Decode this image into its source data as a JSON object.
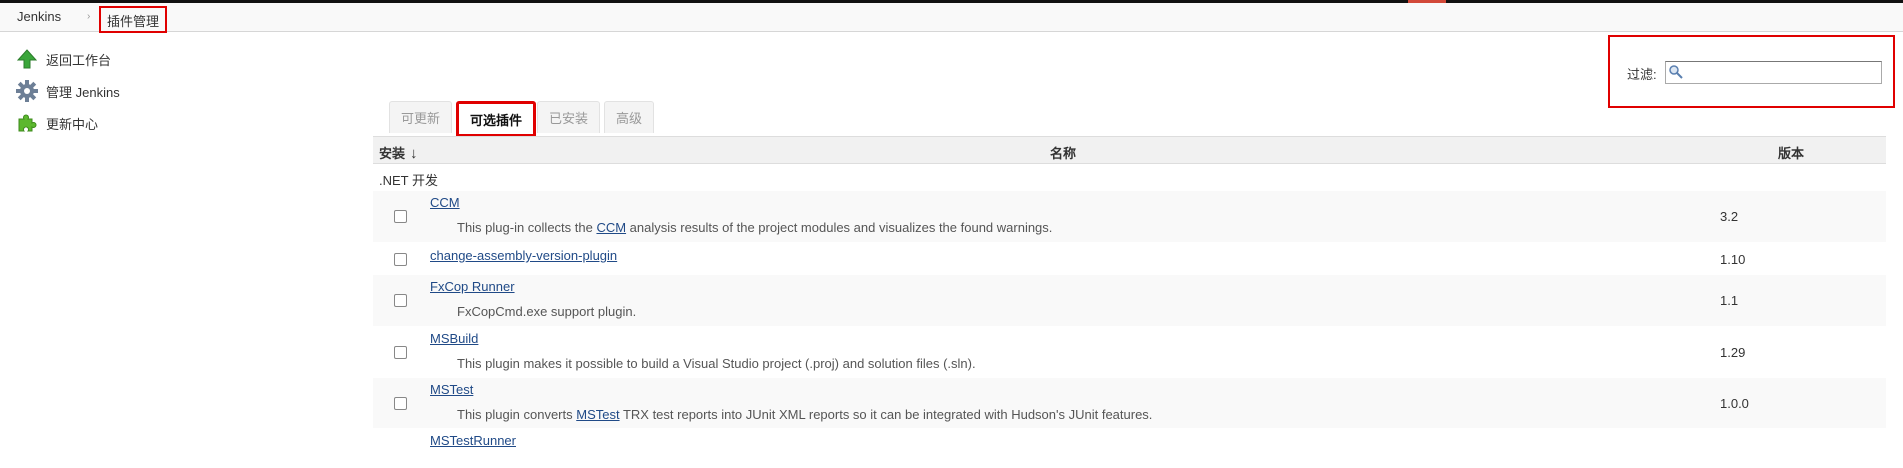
{
  "breadcrumb": {
    "home": "Jenkins",
    "current": "插件管理"
  },
  "sidebar": {
    "items": [
      {
        "label": "返回工作台",
        "icon": "up-arrow-icon"
      },
      {
        "label": "管理 Jenkins",
        "icon": "gear-icon"
      },
      {
        "label": "更新中心",
        "icon": "puzzle-icon"
      }
    ]
  },
  "filter": {
    "label": "过滤:",
    "value": "",
    "placeholder": ""
  },
  "tabs": [
    {
      "label": "可更新",
      "active": false
    },
    {
      "label": "可选插件",
      "active": true
    },
    {
      "label": "已安装",
      "active": false
    },
    {
      "label": "高级",
      "active": false
    }
  ],
  "table": {
    "headers": {
      "install": "安装",
      "sort_indicator": "↓",
      "name": "名称",
      "version": "版本"
    },
    "category": ".NET 开发",
    "plugins": [
      {
        "name": "CCM",
        "desc_before": "This plug-in collects the ",
        "desc_link": "CCM",
        "desc_after": " analysis results of the project modules and visualizes the found warnings.",
        "version": "3.2"
      },
      {
        "name": "change-assembly-version-plugin",
        "desc_before": "",
        "desc_link": "",
        "desc_after": "",
        "version": "1.10"
      },
      {
        "name": "FxCop Runner",
        "desc_before": "FxCopCmd.exe support plugin.",
        "desc_link": "",
        "desc_after": "",
        "version": "1.1"
      },
      {
        "name": "MSBuild",
        "desc_before": "This plugin makes it possible to build a Visual Studio project (.proj) and solution files (.sln).",
        "desc_link": "",
        "desc_after": "",
        "version": "1.29"
      },
      {
        "name": "MSTest",
        "desc_before": "This plugin converts ",
        "desc_link": "MSTest",
        "desc_after": " TRX test reports into JUnit XML reports so it can be integrated with Hudson's JUnit features.",
        "version": "1.0.0"
      },
      {
        "name": "MSTestRunner",
        "desc_before": "",
        "desc_link": "",
        "desc_after": "",
        "version": ""
      }
    ]
  }
}
